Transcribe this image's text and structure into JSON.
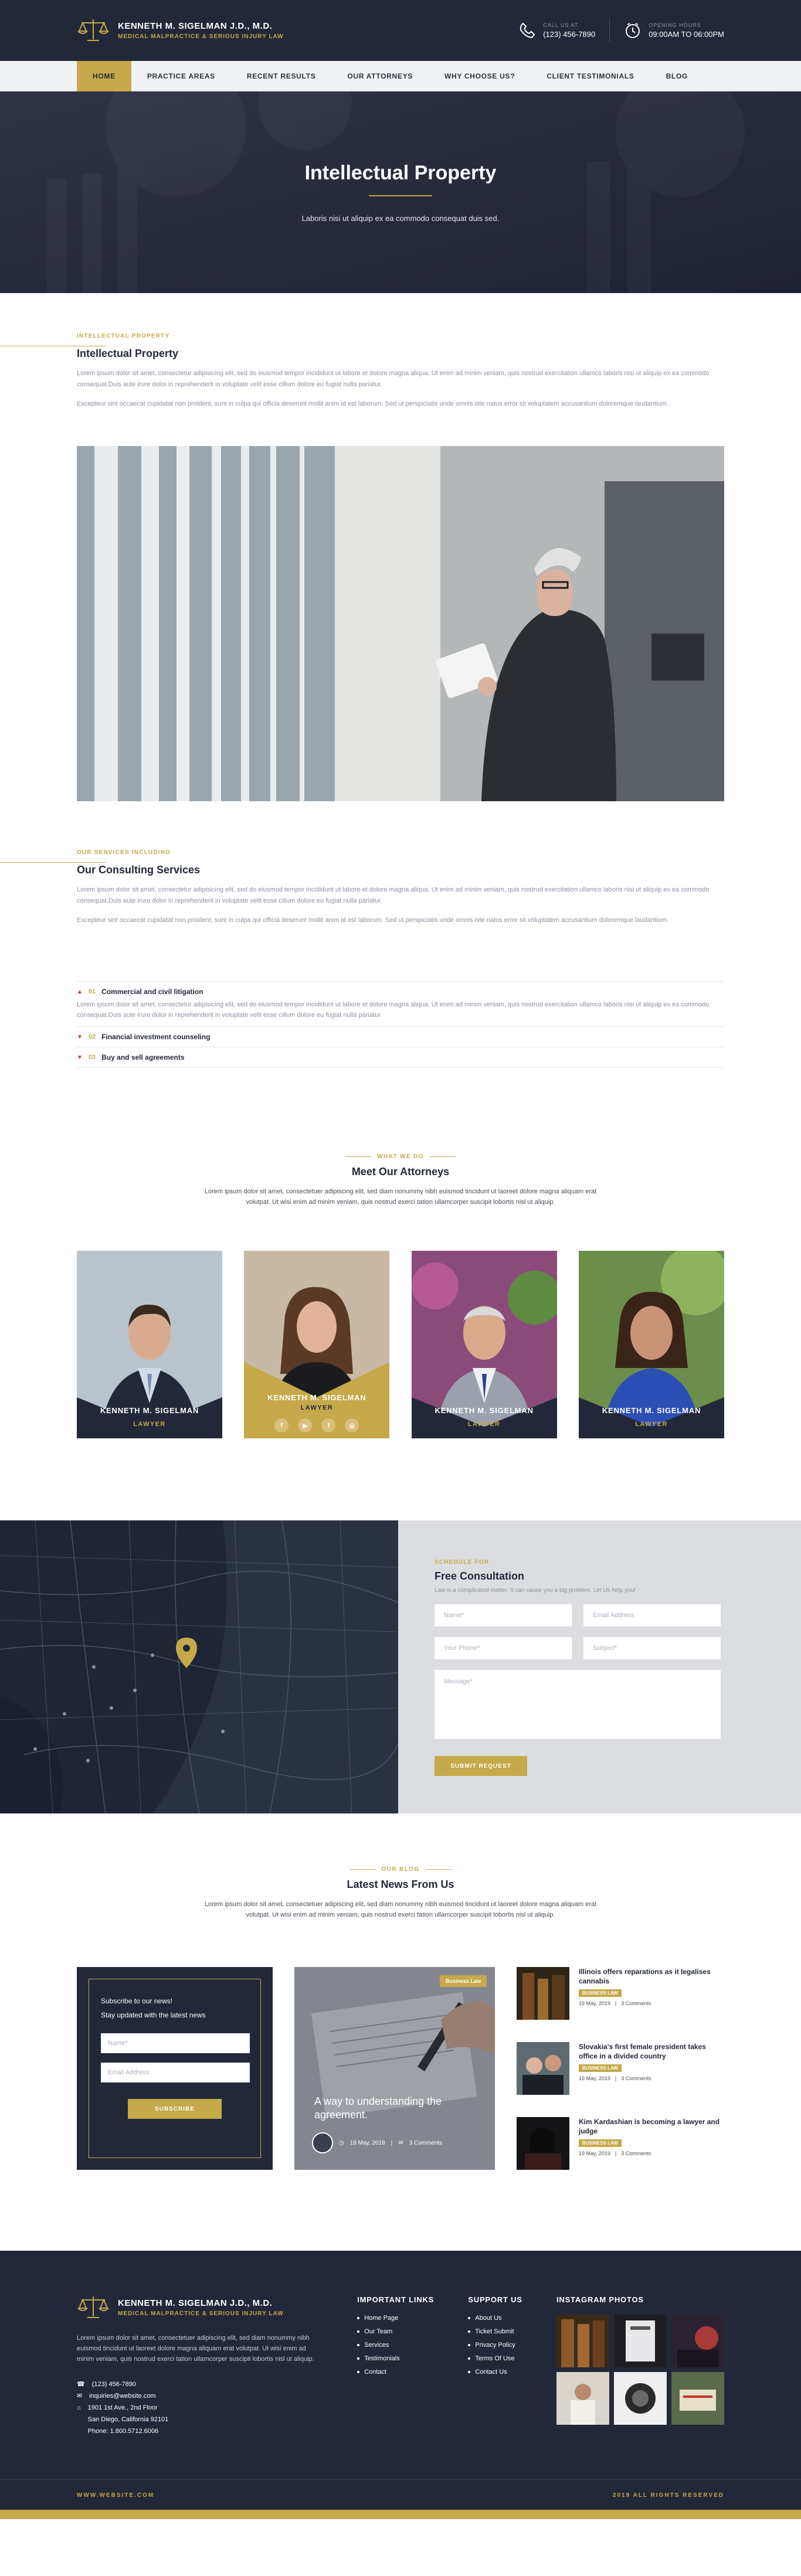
{
  "brand": {
    "title": "KENNETH M. SIGELMAN J.D., M.D.",
    "subtitle": "MEDICAL MALPRACTICE & SERIOUS INJURY LAW"
  },
  "header": {
    "call_label": "CALL US AT",
    "call_value": "(123) 456-7890",
    "hours_label": "OPENING HOURS",
    "hours_value": "09:00AM TO 06:00PM"
  },
  "nav": [
    "HOME",
    "PRACTICE AREAS",
    "RECENT RESULTS",
    "OUR ATTORNEYS",
    "WHY CHOOSE US?",
    "CLIENT TESTIMONIALS",
    "BLOG"
  ],
  "hero": {
    "title": "Intellectual Property",
    "subtitle": "Laboris nisi ut aliquip ex ea commodo consequat duis sed."
  },
  "intro": {
    "eyebrow": "INTELLECTUAL PROPERTY",
    "title": "Intellectual Property",
    "p1": "Lorem ipsum dolor sit amet, consectetur adipisicing elit, sed do eiusmod tempor incididunt ut labore et dolore magna aliqua. Ut enim ad minim veniam, quis nostrud exercitation ullamco laboris nisi ut aliquip ex ea commodo consequat.Duis aute irure dolor in reprehenderit in voluptate velit esse cillum dolore eu fugiat nulla pariatur.",
    "p2": "Excepteur sint occaecat cupidatat non proident, sunt in culpa qui officia deserunt mollit anim id est laborum. Sed ut perspiciatis unde omnis iste natus error sit voluptatem accusantium doloremque laudantium."
  },
  "services": {
    "eyebrow": "OUR SERVICES INCLUDING",
    "title": "Our Consulting Services",
    "p1": "Lorem ipsum dolor sit amet, consectetur adipisicing elit, sed do eiusmod tempor incididunt ut labore et dolore magna aliqua. Ut enim ad minim veniam, quis nostrud exercitation ullamco laboris nisi ut aliquip ex ea commodo consequat.Duis aute irure dolor in reprehenderit in voluptate velit esse cillum dolore eu fugiat nulla pariatur.",
    "p2": "Excepteur sint occaecat cupidatat non proident, sunt in culpa qui officia deserunt mollit anim id est laborum. Sed ut perspiciatis unde omnis iste natus error sit voluptatem accusantium doloremque laudantium."
  },
  "accordion": [
    {
      "num": "01",
      "title": "Commercial and civil litigation",
      "body": "Lorem ipsum dolor sit amet, consectetur adipisicing elit, sed do eiusmod tempor incididunt ut labore et dolore magna aliqua. Ut enim ad minim veniam, quis nostrud exercitation ullamco laboris nisi ut aliquip ex ea commodo consequat.Duis aute irure dolor in reprehenderit in voluptate velit esse cillum dolore eu fugiat nulla pariatur."
    },
    {
      "num": "02",
      "title": "Financial investment counseling",
      "body": ""
    },
    {
      "num": "03",
      "title": "Buy and sell agreements",
      "body": ""
    }
  ],
  "attorneys_section": {
    "eyebrow": "WHAT WE DO",
    "title": "Meet Our Attorneys",
    "text": "Lorem ipsum dolor sit amet, consectetuer adipiscing elit, sed diam nonummy nibh euismod tincidunt ut laoreet dolore magna aliquam erat volutpat. Ut wisi enim ad minim veniam, quis nostrud exerci tation ullamcorper suscipit lobortis nisl ut aliquip."
  },
  "attorneys": [
    {
      "name": "KENNETH M. SIGELMAN",
      "role": "LAWYER"
    },
    {
      "name": "KENNETH M. SIGELMAN",
      "role": "LAWYER"
    },
    {
      "name": "KENNETH M. SIGELMAN",
      "role": "LAWYER"
    },
    {
      "name": "KENNETH M. SIGELMAN",
      "role": "LAWYER"
    }
  ],
  "consultation": {
    "eyebrow": "SCHEDULE FOR",
    "title": "Free Consultation",
    "note": "Law is a complicated matter. It can cause you a big problem. Let Us help you!",
    "name_ph": "Name*",
    "email_ph": "Email Address",
    "phone_ph": "Your Phone*",
    "subject_ph": "Subject*",
    "message_ph": "Message*",
    "submit": "SUBMIT REQUEST"
  },
  "blog": {
    "eyebrow": "OUR BLOG",
    "title": "Latest News From Us",
    "text": "Lorem ipsum dolor sit amet, consectetuer adipiscing elit, sed diam nonummy nibh euismod tincidunt ut laoreet dolore magna aliquam erat volutpat. Ut wisi enim ad minim veniam, quis nostrud exerci tation ullamcorper suscipit lobortis nisl ut aliquip."
  },
  "newsletter": {
    "line1": "Subscribe to our news!",
    "line2": "Stay updated with the latest news",
    "name_ph": "Name*",
    "email_ph": "Email Address",
    "button": "SUBSCRIBE"
  },
  "featured": {
    "tag": "Business Law",
    "title": "A way to understanding the agreement.",
    "date": "19 May, 2019",
    "comments": "3 Comments"
  },
  "side_news": [
    {
      "title": "Illinois offers reparations as it legalises cannabis",
      "tag": "BUSINESS LAW",
      "date": "19 May, 2019",
      "comments": "3 Comments"
    },
    {
      "title": "Slovakia's first female president takes office in a divided country",
      "tag": "BUSINESS LAW",
      "date": "19 May, 2019",
      "comments": "3 Comments"
    },
    {
      "title": "Kim Kardashian is becoming a lawyer and judge",
      "tag": "BUSINESS LAW",
      "date": "19 May, 2019",
      "comments": "3 Comments"
    }
  ],
  "footer": {
    "about": "Lorem ipsum dolor sit amet, consectetuer adipiscing elit, sed diam nonummy nibh euismod tincidunt ut laoreet dolore magna aliquam erat volutpat. Ut wisi enim ad minim veniam, quis nostrud exerci tation ullamcorper suscipit lobortis nisl ut aliquip.",
    "phone": "(123) 456-7890",
    "email": "inquiries@website.com",
    "address1": "1901 1st Ave., 2nd Floor",
    "address2": "San Diego, California 92101",
    "address3": "Phone: 1.800.5712.6006",
    "links_title": "IMPORTANT LINKS",
    "links": [
      "Home Page",
      "Our Team",
      "Services",
      "Testimonials",
      "Contact"
    ],
    "support_title": "SUPPORT US",
    "support": [
      "About Us",
      "Ticket Submit",
      "Privacy Policy",
      "Terms Of Use",
      "Contact Us"
    ],
    "insta_title": "INSTAGRAM PHOTOS",
    "site": "WWW.WEBSITE.COM",
    "rights": "2019 ALL RIGHTS RESERVED"
  },
  "colors": {
    "navy": "#232838",
    "gold": "#c5a94a",
    "light": "#f0f1f3"
  },
  "icons": [
    "scales-logo-icon",
    "phone-icon",
    "clock-icon",
    "facebook-icon",
    "youtube-icon",
    "twitter-icon",
    "instagram-icon",
    "map-pin-icon",
    "calendar-icon",
    "comment-icon",
    "mail-icon",
    "location-icon"
  ]
}
